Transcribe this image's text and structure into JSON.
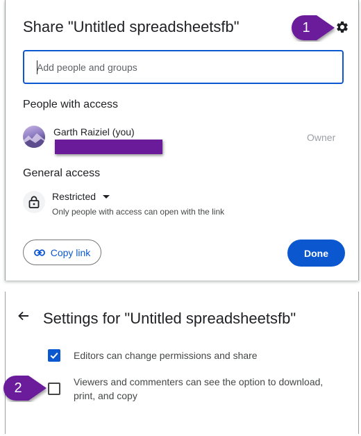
{
  "share_dialog": {
    "title": "Share \"Untitled spreadsheetsfb\"",
    "search": {
      "placeholder": "Add people and groups",
      "value": ""
    },
    "people_heading": "People with access",
    "user": {
      "name": "Garth Raiziel (you)",
      "role": "Owner"
    },
    "general_heading": "General access",
    "access": {
      "level": "Restricted",
      "description": "Only people with access can open with the link"
    },
    "copy_link_label": "Copy link",
    "done_label": "Done"
  },
  "settings": {
    "title": "Settings for \"Untitled spreadsheetsfb\"",
    "options": [
      {
        "label": "Editors can change permissions and share",
        "checked": true
      },
      {
        "label": "Viewers and commenters can see the option to download, print, and copy",
        "checked": false
      }
    ]
  },
  "callouts": [
    {
      "number": "1"
    },
    {
      "number": "2"
    }
  ],
  "colors": {
    "accent": "#0b57d0",
    "callout": "#6a1b9a",
    "redaction": "#6a1b9a"
  },
  "icons": [
    "gear-icon",
    "avatar",
    "lock-icon",
    "dropdown-arrow-icon",
    "link-icon",
    "back-arrow-icon",
    "checkmark-icon"
  ]
}
